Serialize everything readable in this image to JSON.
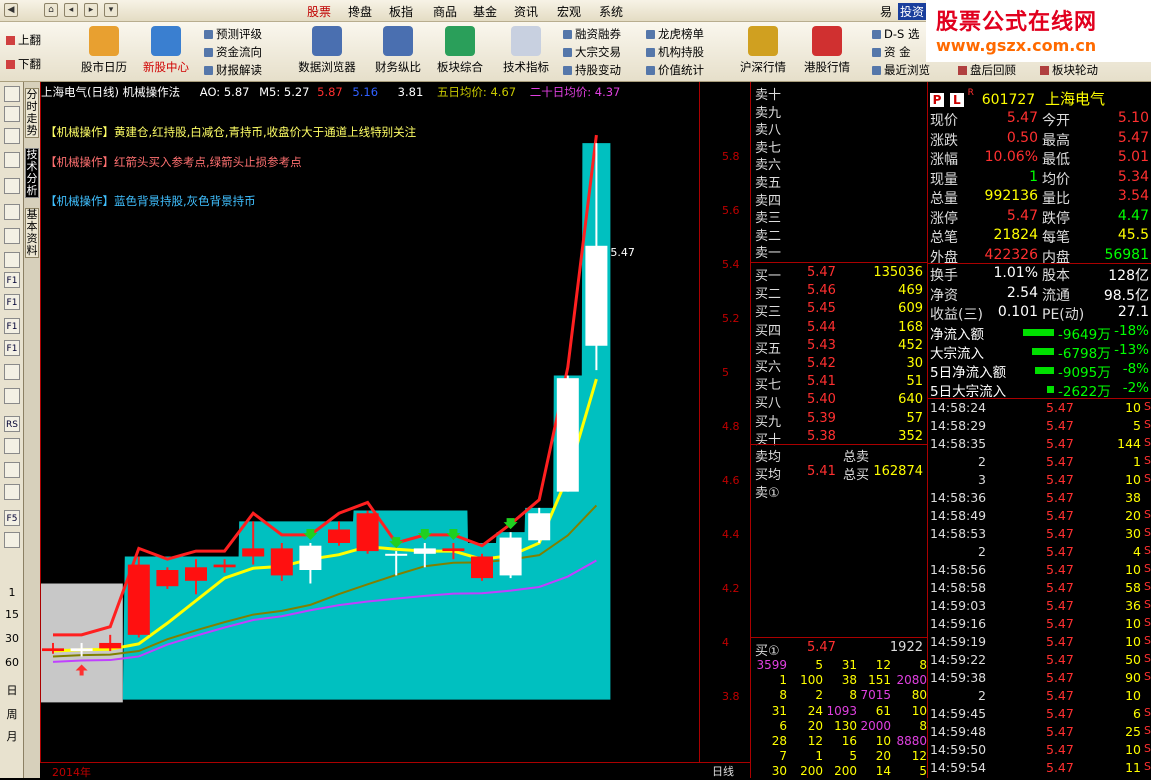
{
  "menu": {
    "items": [
      "股票",
      "搀盘",
      "板指",
      "商品",
      "基金",
      "资讯",
      "宏观",
      "系统"
    ],
    "active_index": 0,
    "right_partial": [
      "易",
      "投资"
    ]
  },
  "toolbar": {
    "left_up": "上翻",
    "left_down": "下翻",
    "big_buttons": [
      {
        "label": "股市日历",
        "icon": "calendar-icon"
      },
      {
        "label": "新股中心",
        "icon": "new-stock-icon",
        "highlight": true
      },
      {
        "label": "数据浏览器",
        "icon": "data-browser-icon"
      },
      {
        "label": "财务纵比",
        "icon": "finance-icon"
      },
      {
        "label": "板块综合",
        "icon": "sector-icon"
      },
      {
        "label": "技术指标",
        "icon": "indicator-icon"
      },
      {
        "label": "沪深行情",
        "icon": "sh-sz-icon"
      },
      {
        "label": "港股行情",
        "icon": "hk-icon"
      }
    ],
    "small_group1": [
      "预测评级",
      "资金流向",
      "财报解读"
    ],
    "small_group2": [
      "融资融券",
      "大宗交易",
      "持股变动"
    ],
    "small_group3": [
      "龙虎榜单",
      "机构持股",
      "价值统计"
    ],
    "small_group4": [
      "D-S 选",
      "资 金",
      "最近浏览"
    ],
    "bottom_small": [
      "盘后回顾",
      "板块轮动"
    ]
  },
  "watermark": {
    "line1": "股票公式在线网",
    "line2": "www.gszx.com.cn"
  },
  "vtabs": [
    "分时走势",
    "技术分析",
    "基本资料"
  ],
  "leftbar": {
    "icons": [
      "arrow-left-icon",
      "arrow-right-icon",
      "arrow-up-icon",
      "list-icon",
      "table-icon",
      "line-icon",
      "candle-icon",
      "chart-icon",
      "f10-icon",
      "f10b-icon",
      "f11-icon",
      "f12-icon",
      "f13-icon",
      "vol-icon",
      "rsi-icon",
      "dollar-icon",
      "move-icon",
      "pencil-icon",
      "f5-icon",
      "refresh-icon"
    ],
    "icon_text": [
      "F10",
      "F11",
      "F12",
      "RSI",
      "F5"
    ],
    "periods": [
      "1",
      "15",
      "30",
      "60",
      "日",
      "周",
      "月"
    ]
  },
  "chart": {
    "header": {
      "title": "上海电气(日线) 机械操作法",
      "ao": "AO: 5.87",
      "m5_label": "M5: 5.27",
      "m5_extra": "5.87",
      "m5_extra2": "5.16",
      "val": "3.81",
      "ma5": "五日均价: 4.67",
      "ma20": "二十日均价: 4.37"
    },
    "annotations": [
      {
        "text": "【机械操作】黄建仓,红持股,白减仓,青持币,收盘价大于通道上线特别关注",
        "color": "#ffff66"
      },
      {
        "text": "【机械操作】红箭头买入参考点,绿箭头止损参考点",
        "color": "#ff7070"
      },
      {
        "text": "【机械操作】蓝色背景持股,灰色背景持币",
        "color": "#40c0ff"
      }
    ],
    "last_label": "5.47",
    "year_label": "2014年",
    "period_label": "日线"
  },
  "chart_data": {
    "type": "candlestick",
    "ylim": [
      3.7,
      5.98
    ],
    "yticks": [
      3.8,
      4.0,
      4.2,
      4.4,
      4.6,
      4.8,
      5.0,
      5.2,
      5.4,
      5.6,
      5.8
    ],
    "candles": [
      {
        "o": 3.98,
        "h": 4.0,
        "l": 3.96,
        "c": 3.97
      },
      {
        "o": 3.97,
        "h": 4.0,
        "l": 3.95,
        "c": 3.98
      },
      {
        "o": 4.0,
        "h": 4.03,
        "l": 3.97,
        "c": 3.98
      },
      {
        "o": 4.29,
        "h": 4.32,
        "l": 4.02,
        "c": 4.03
      },
      {
        "o": 4.27,
        "h": 4.28,
        "l": 4.2,
        "c": 4.21
      },
      {
        "o": 4.28,
        "h": 4.31,
        "l": 4.18,
        "c": 4.23
      },
      {
        "o": 4.29,
        "h": 4.31,
        "l": 4.26,
        "c": 4.28
      },
      {
        "o": 4.35,
        "h": 4.45,
        "l": 4.29,
        "c": 4.32
      },
      {
        "o": 4.35,
        "h": 4.37,
        "l": 4.23,
        "c": 4.25
      },
      {
        "o": 4.27,
        "h": 4.37,
        "l": 4.22,
        "c": 4.36
      },
      {
        "o": 4.42,
        "h": 4.45,
        "l": 4.36,
        "c": 4.37
      },
      {
        "o": 4.48,
        "h": 4.49,
        "l": 4.33,
        "c": 4.34
      },
      {
        "o": 4.33,
        "h": 4.34,
        "l": 4.25,
        "c": 4.33
      },
      {
        "o": 4.33,
        "h": 4.37,
        "l": 4.28,
        "c": 4.35
      },
      {
        "o": 4.35,
        "h": 4.37,
        "l": 4.31,
        "c": 4.34
      },
      {
        "o": 4.32,
        "h": 4.33,
        "l": 4.23,
        "c": 4.24
      },
      {
        "o": 4.25,
        "h": 4.41,
        "l": 4.24,
        "c": 4.39
      },
      {
        "o": 4.38,
        "h": 4.5,
        "l": 4.37,
        "c": 4.48
      },
      {
        "o": 4.56,
        "h": 4.99,
        "l": 4.56,
        "c": 4.98
      },
      {
        "o": 5.1,
        "h": 5.85,
        "l": 5.01,
        "c": 5.47
      }
    ],
    "green_arrow_at": [
      9,
      12,
      13,
      14,
      16
    ],
    "red_arrow_at": [
      1
    ]
  },
  "orderbook": {
    "sell_labels": [
      "卖十",
      "卖九",
      "卖八",
      "卖七",
      "卖六",
      "卖五",
      "卖四",
      "卖三",
      "卖二",
      "卖一"
    ],
    "buy": [
      {
        "label": "买一",
        "price": "5.47",
        "vol": "135036"
      },
      {
        "label": "买二",
        "price": "5.46",
        "vol": "469"
      },
      {
        "label": "买三",
        "price": "5.45",
        "vol": "609"
      },
      {
        "label": "买四",
        "price": "5.44",
        "vol": "168"
      },
      {
        "label": "买五",
        "price": "5.43",
        "vol": "452"
      },
      {
        "label": "买六",
        "price": "5.42",
        "vol": "30"
      },
      {
        "label": "买七",
        "price": "5.41",
        "vol": "51"
      },
      {
        "label": "买八",
        "price": "5.40",
        "vol": "640"
      },
      {
        "label": "买九",
        "price": "5.39",
        "vol": "57"
      },
      {
        "label": "买十",
        "price": "5.38",
        "vol": "352"
      }
    ],
    "avg_sell": "卖均",
    "total_sell": "总卖",
    "avg_buy": "买均",
    "avg_buy_val": "5.41",
    "total_buy": "总买",
    "total_buy_val": "162874",
    "sell1_label": "卖①",
    "buy1_label": "买①",
    "buy1_price": "5.47",
    "buy1_vol": "1922",
    "queue": [
      [
        "3599",
        "5",
        "31",
        "12",
        "8"
      ],
      [
        "1",
        "100",
        "38",
        "151",
        "2080"
      ],
      [
        "8",
        "2",
        "8",
        "7015",
        "80"
      ],
      [
        "31",
        "24",
        "1093",
        "61",
        "10"
      ],
      [
        "6",
        "20",
        "130",
        "2000",
        "8"
      ],
      [
        "28",
        "12",
        "16",
        "10",
        "8880"
      ],
      [
        "7",
        "1",
        "5",
        "20",
        "12"
      ],
      [
        "30",
        "200",
        "200",
        "14",
        "5"
      ]
    ]
  },
  "quote": {
    "badges": [
      "P",
      "L",
      "R"
    ],
    "code": "601727",
    "name": "上海电气",
    "rows": [
      {
        "k1": "现价",
        "v1": "5.47",
        "c1": "#ff3030",
        "k2": "今开",
        "v2": "5.10",
        "c2": "#ff3030"
      },
      {
        "k1": "涨跌",
        "v1": "0.50",
        "c1": "#ff3030",
        "k2": "最高",
        "v2": "5.47",
        "c2": "#ff3030"
      },
      {
        "k1": "涨幅",
        "v1": "10.06%",
        "c1": "#ff3030",
        "k2": "最低",
        "v2": "5.01",
        "c2": "#ff3030"
      },
      {
        "k1": "现量",
        "v1": "1",
        "c1": "#00ff00",
        "k2": "均价",
        "v2": "5.34",
        "c2": "#ff3030"
      },
      {
        "k1": "总量",
        "v1": "992136",
        "c1": "#ffff00",
        "k2": "量比",
        "v2": "3.54",
        "c2": "#ff3030"
      },
      {
        "k1": "涨停",
        "v1": "5.47",
        "c1": "#ff3030",
        "k2": "跌停",
        "v2": "4.47",
        "c2": "#00ff00"
      },
      {
        "k1": "总笔",
        "v1": "21824",
        "c1": "#ffff00",
        "k2": "每笔",
        "v2": "45.5",
        "c2": "#ffff00"
      },
      {
        "k1": "外盘",
        "v1": "422326",
        "c1": "#ff3030",
        "k2": "内盘",
        "v2": "56981",
        "c2": "#00ff00"
      }
    ],
    "rows2": [
      {
        "k1": "换手",
        "v1": "1.01%",
        "c1": "#ffffff",
        "k2": "股本",
        "v2": "128亿",
        "c2": "#ffffff"
      },
      {
        "k1": "净资",
        "v1": "2.54",
        "c1": "#ffffff",
        "k2": "流通",
        "v2": "98.5亿",
        "c2": "#ffffff"
      },
      {
        "k1": "收益(三)",
        "v1": "0.101",
        "c1": "#ffffff",
        "k2": "PE(动)",
        "v2": "27.1",
        "c2": "#ffffff"
      }
    ],
    "flows": [
      {
        "k": "净流入额",
        "v": "-9649万",
        "pct": "-18%",
        "bar": 0.9
      },
      {
        "k": "大宗流入",
        "v": "-6798万",
        "pct": "-13%",
        "bar": 0.65
      },
      {
        "k": "5日净流入额",
        "v": "-9095万",
        "pct": "-8%",
        "bar": 0.55
      },
      {
        "k": "5日大宗流入",
        "v": "-2622万",
        "pct": "-2%",
        "bar": 0.2
      }
    ],
    "ticks": [
      {
        "t": "14:58:24",
        "p": "5.47",
        "v": "10",
        "d": "S"
      },
      {
        "t": "14:58:29",
        "p": "5.47",
        "v": "5",
        "d": "S"
      },
      {
        "t": "14:58:35",
        "p": "5.47",
        "v": "144",
        "d": "S"
      },
      {
        "t": "2",
        "p": "5.47",
        "v": "1",
        "d": "S"
      },
      {
        "t": "3",
        "p": "5.47",
        "v": "10",
        "d": "S"
      },
      {
        "t": "14:58:36",
        "p": "5.47",
        "v": "38",
        "d": ""
      },
      {
        "t": "14:58:49",
        "p": "5.47",
        "v": "20",
        "d": "S"
      },
      {
        "t": "14:58:53",
        "p": "5.47",
        "v": "30",
        "d": "S"
      },
      {
        "t": "2",
        "p": "5.47",
        "v": "4",
        "d": "S"
      },
      {
        "t": "14:58:56",
        "p": "5.47",
        "v": "10",
        "d": "S"
      },
      {
        "t": "14:58:58",
        "p": "5.47",
        "v": "58",
        "d": "S"
      },
      {
        "t": "14:59:03",
        "p": "5.47",
        "v": "36",
        "d": "S"
      },
      {
        "t": "14:59:16",
        "p": "5.47",
        "v": "10",
        "d": "S"
      },
      {
        "t": "14:59:19",
        "p": "5.47",
        "v": "10",
        "d": "S"
      },
      {
        "t": "14:59:22",
        "p": "5.47",
        "v": "50",
        "d": "S"
      },
      {
        "t": "14:59:38",
        "p": "5.47",
        "v": "90",
        "d": "S"
      },
      {
        "t": "2",
        "p": "5.47",
        "v": "10",
        "d": ""
      },
      {
        "t": "14:59:45",
        "p": "5.47",
        "v": "6",
        "d": "S"
      },
      {
        "t": "14:59:48",
        "p": "5.47",
        "v": "25",
        "d": "S"
      },
      {
        "t": "14:59:50",
        "p": "5.47",
        "v": "10",
        "d": "S"
      },
      {
        "t": "14:59:54",
        "p": "5.47",
        "v": "11",
        "d": "S"
      }
    ]
  }
}
